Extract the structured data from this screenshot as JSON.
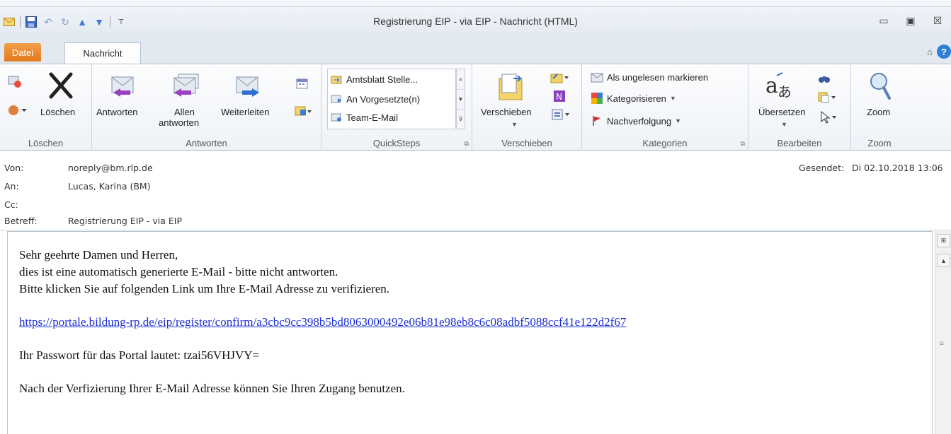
{
  "window": {
    "title": "Registrierung EIP - via EIP - Nachricht (HTML)"
  },
  "tabs": {
    "file": "Datei",
    "message": "Nachricht"
  },
  "ribbon": {
    "loeschen": {
      "delete_label": "Löschen",
      "group": "Löschen"
    },
    "antworten": {
      "reply": "Antworten",
      "reply_all_1": "Allen",
      "reply_all_2": "antworten",
      "forward": "Weiterleiten",
      "group": "Antworten"
    },
    "quicksteps": {
      "items": [
        "Amtsblatt Stelle...",
        "An Vorgesetzte(n)",
        "Team-E-Mail"
      ],
      "group": "QuickSteps"
    },
    "verschieben": {
      "move": "Verschieben",
      "group": "Verschieben"
    },
    "kategorien": {
      "mark_unread": "Als ungelesen markieren",
      "categorize": "Kategorisieren",
      "followup": "Nachverfolgung",
      "group": "Kategorien"
    },
    "bearbeiten": {
      "translate": "Übersetzen",
      "group": "Bearbeiten"
    },
    "zoom": {
      "zoom": "Zoom",
      "group": "Zoom"
    }
  },
  "header": {
    "from_label": "Von:",
    "from": "noreply@bm.rlp.de",
    "to_label": "An:",
    "to": "Lucas, Karina (BM)",
    "cc_label": "Cc:",
    "subject_label": "Betreff:",
    "subject": "Registrierung EIP - via EIP",
    "sent_label": "Gesendet:",
    "sent": "Di 02.10.2018 13:06"
  },
  "body": {
    "line1": "Sehr geehrte Damen und Herren,",
    "line2": "dies ist eine automatisch generierte E-Mail - bitte nicht antworten.",
    "line3": "Bitte klicken Sie auf folgenden Link um Ihre E-Mail Adresse zu verifizieren.",
    "link": "https://portale.bildung-rp.de/eip/register/confirm/a3cbc9cc398b5bd8063000492e06b81e98eb8c6c08adbf5088ccf41e122d2f67",
    "password_line": "Ihr Passwort für das Portal lautet: tzai56VHJVY=",
    "last_line": "Nach der Verfizierung Ihrer E-Mail Adresse können Sie Ihren Zugang benutzen."
  }
}
